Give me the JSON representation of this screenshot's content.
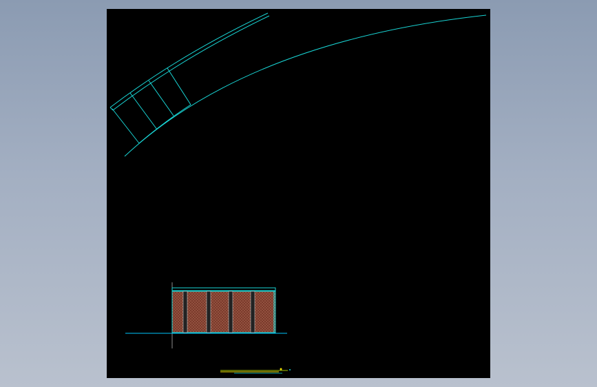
{
  "colors": {
    "workspace_background": "#8b9bb2",
    "canvas_background": "#000000",
    "cad_line": "#19d6d6",
    "crosshair": "#8c8c8c",
    "baseline": "#00c8ff",
    "brick_fill": "#7a3a2b",
    "brick_hatch": "#c0c0c0",
    "note_green": "#a8c800",
    "note_yellow": "#f0e000"
  },
  "icons": {
    "crosshair": "crosshair-icon"
  }
}
